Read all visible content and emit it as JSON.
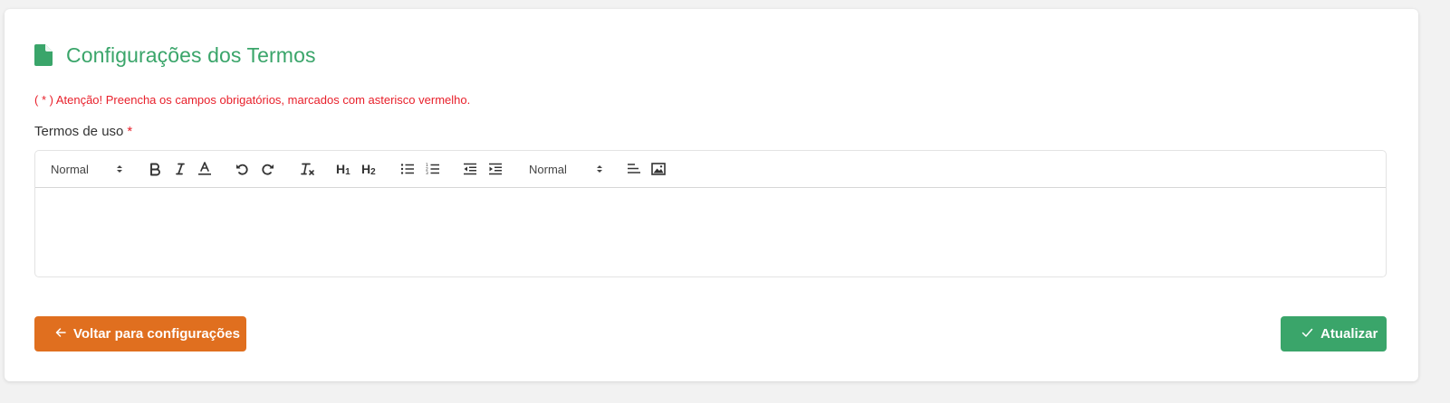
{
  "page": {
    "title": "Configurações dos Termos",
    "title_icon": "file-icon",
    "warning": "( * ) Atenção! Preencha os campos obrigatórios, marcados com asterisco vermelho."
  },
  "field": {
    "label": "Termos de uso",
    "required_mark": "*",
    "value": ""
  },
  "toolbar": {
    "header_picker": "Normal",
    "size_picker": "Normal",
    "h1": "H",
    "h1_sub": "1",
    "h2": "H",
    "h2_sub": "2",
    "icons": [
      "bold-icon",
      "italic-icon",
      "text-color-icon",
      "undo-icon",
      "redo-icon",
      "clear-format-icon",
      "bullet-list-icon",
      "ordered-list-icon",
      "outdent-icon",
      "indent-icon",
      "align-icon",
      "image-icon"
    ]
  },
  "buttons": {
    "back": "Voltar para configurações",
    "update": "Atualizar"
  },
  "colors": {
    "primary_green": "#3aa56a",
    "back_orange": "#e06f1f",
    "warning_red": "#e8202b"
  }
}
